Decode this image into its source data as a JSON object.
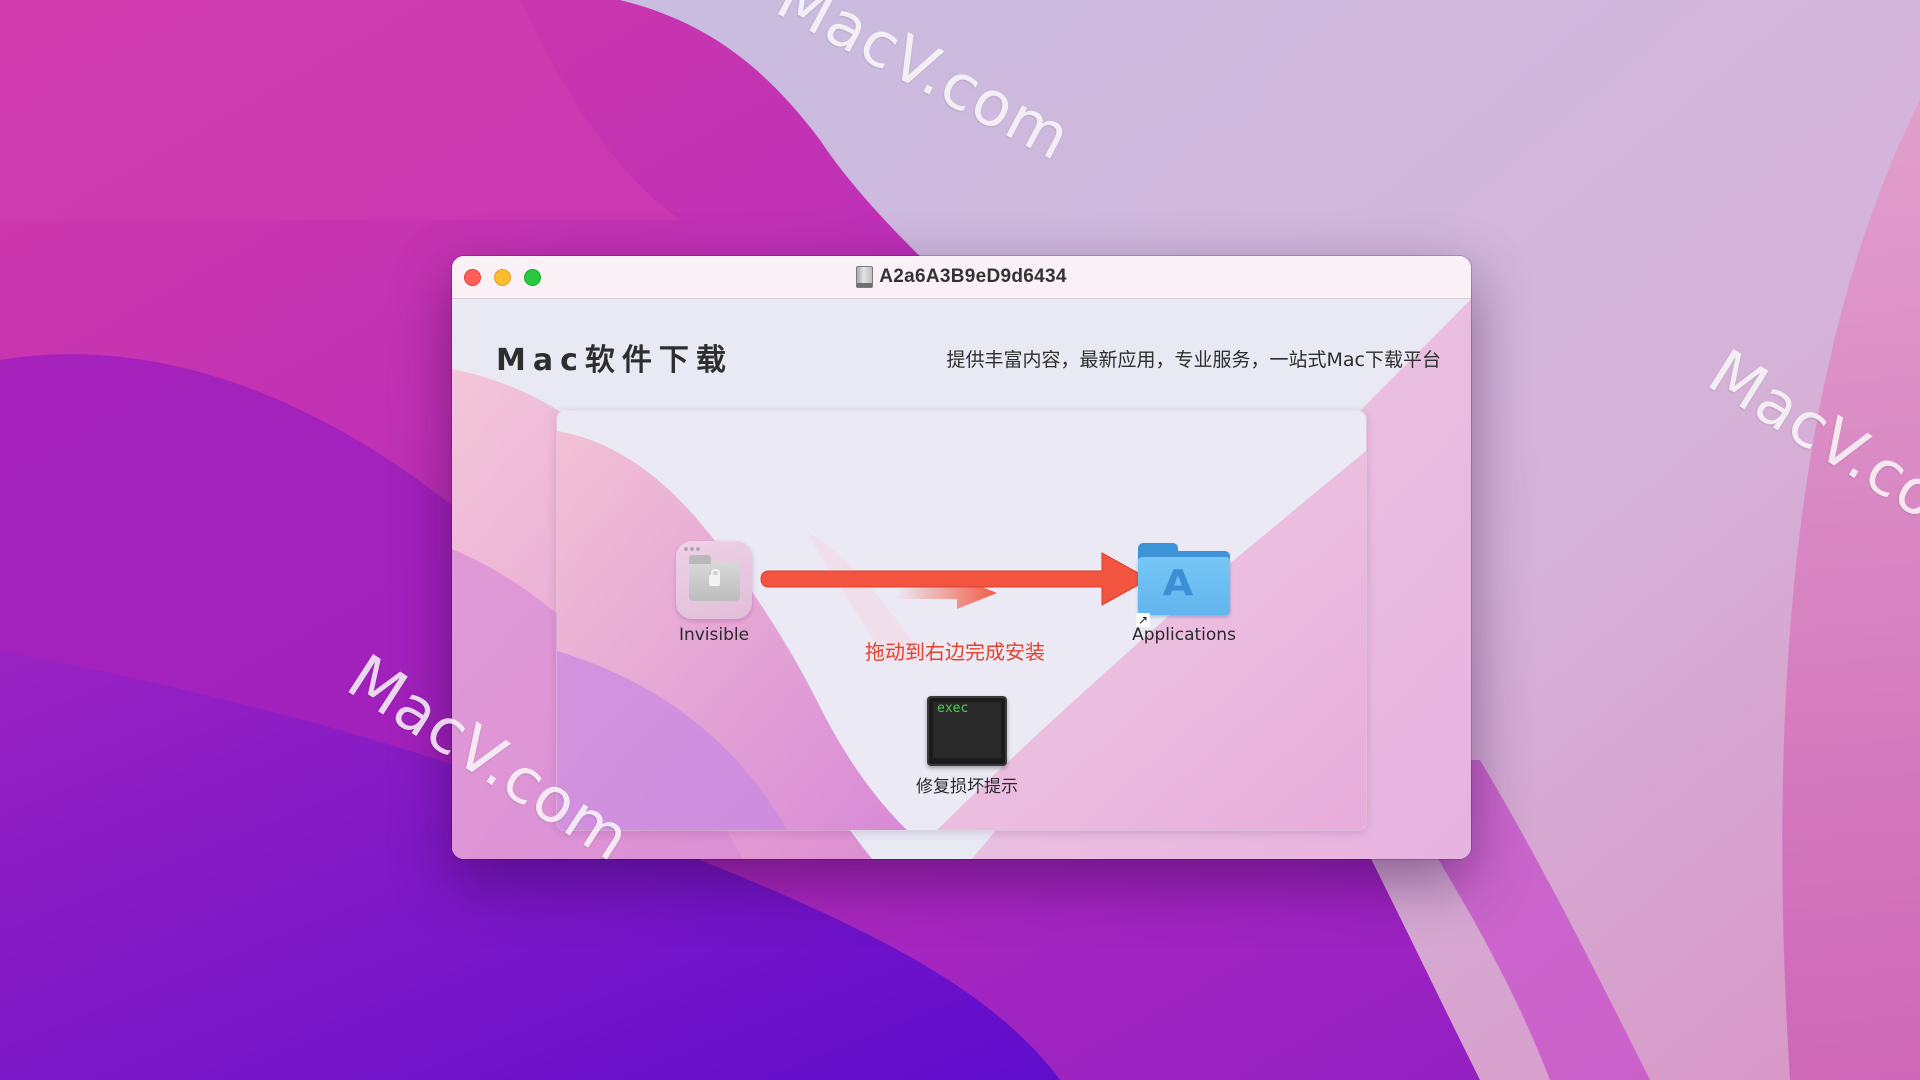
{
  "desktop": {
    "watermarks": [
      "MacV.com",
      "MacV.com",
      "MacV.com"
    ],
    "colors": {
      "wallpaper_magenta": "#c935b0",
      "wallpaper_purple": "#6a10c8",
      "wallpaper_lavender": "#c6b9dd",
      "wallpaper_pink": "#d977b8"
    }
  },
  "window": {
    "title": "A2a6A3B9eD9d6434",
    "title_icon": "disk-image-icon",
    "traffic_lights": {
      "close": "#ff5f57",
      "minimize": "#febc2e",
      "maximize": "#28c840"
    }
  },
  "installer": {
    "brand": "Mac软件下载",
    "slogan": "提供丰富内容，最新应用，专业服务，一站式Mac下载平台",
    "drag_hint": "拖动到右边完成安装",
    "drag_hint_color": "#e2432f",
    "arrow_color": "#f2543f",
    "items": [
      {
        "label": "Invisible",
        "icon": "locked-folder-app-icon"
      },
      {
        "label": "Applications",
        "icon": "applications-folder-icon",
        "alias": true
      },
      {
        "label": "修复损坏提示",
        "icon": "exec-terminal-icon",
        "icon_text": "exec"
      }
    ]
  }
}
